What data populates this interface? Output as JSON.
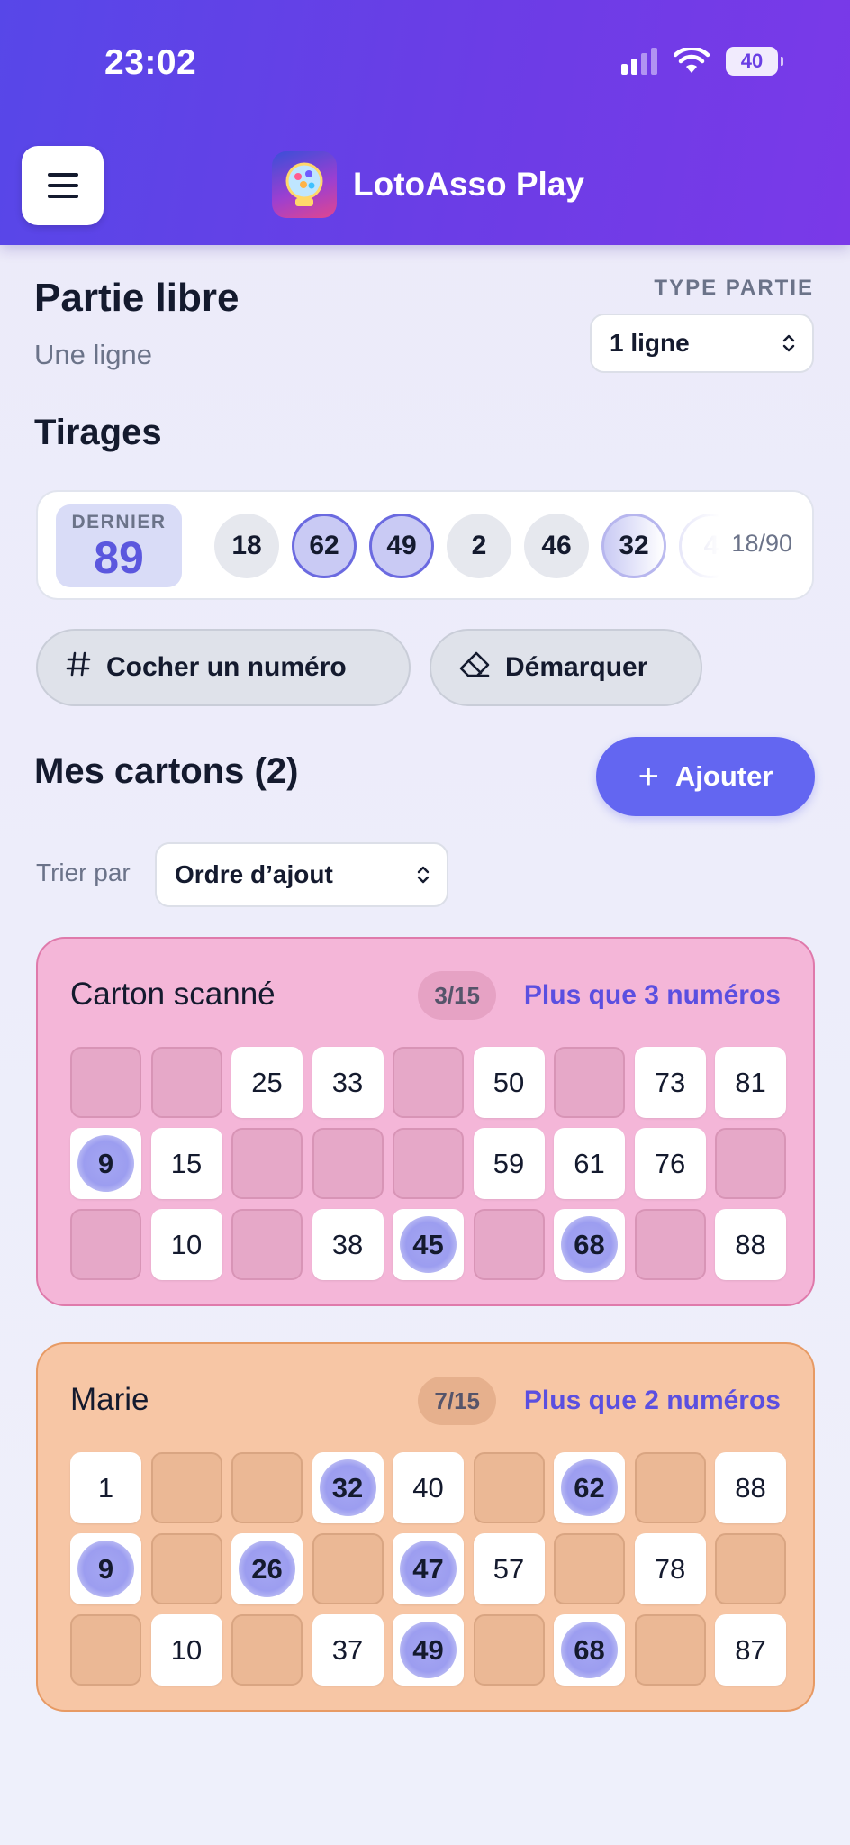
{
  "status_bar": {
    "time": "23:02",
    "battery": "40"
  },
  "header": {
    "app_title": "LotoAsso Play"
  },
  "game": {
    "title": "Partie libre",
    "subtitle": "Une ligne",
    "type_label": "TYPE PARTIE",
    "type_value": "1 ligne"
  },
  "draws": {
    "section_title": "Tirages",
    "last_label": "DERNIER",
    "last_value": "89",
    "balls": [
      {
        "value": "18",
        "style": "plain"
      },
      {
        "value": "62",
        "style": "hl"
      },
      {
        "value": "49",
        "style": "hl"
      },
      {
        "value": "2",
        "style": "plain"
      },
      {
        "value": "46",
        "style": "plain"
      },
      {
        "value": "32",
        "style": "fade"
      },
      {
        "value": "4",
        "style": "ghost"
      }
    ],
    "counter": "18/90"
  },
  "actions": {
    "mark_label": "Cocher un numéro",
    "unmark_label": "Démarquer"
  },
  "cards_section": {
    "title": "Mes cartons (2)",
    "add_label": "Ajouter",
    "sort_label": "Trier par",
    "sort_value": "Ordre d’ajout"
  },
  "cards": [
    {
      "name": "Carton scanné",
      "count": "3/15",
      "hint": "Plus que 3 numéros",
      "color": "pink",
      "rows": [
        [
          "",
          "",
          "25",
          "33",
          "",
          "50",
          "",
          "73",
          "81"
        ],
        [
          "9",
          "15",
          "",
          "",
          "",
          "59",
          "61",
          "76",
          ""
        ],
        [
          "",
          "10",
          "",
          "38",
          "45",
          "",
          "68",
          "",
          "88"
        ]
      ],
      "marked": [
        "9",
        "45",
        "68"
      ]
    },
    {
      "name": "Marie",
      "count": "7/15",
      "hint": "Plus que 2 numéros",
      "color": "orange",
      "rows": [
        [
          "1",
          "",
          "",
          "32",
          "40",
          "",
          "62",
          "",
          "88"
        ],
        [
          "9",
          "",
          "26",
          "",
          "47",
          "57",
          "",
          "78",
          ""
        ],
        [
          "",
          "10",
          "",
          "37",
          "49",
          "",
          "68",
          "",
          "87"
        ]
      ],
      "marked": [
        "32",
        "62",
        "9",
        "26",
        "47",
        "49",
        "68"
      ]
    }
  ],
  "colors": {
    "accent": "#6366f1",
    "header_start": "#5747e8",
    "header_end": "#7a39e8",
    "card_pink": "#f4b6d8",
    "card_orange": "#f7c6a5"
  }
}
